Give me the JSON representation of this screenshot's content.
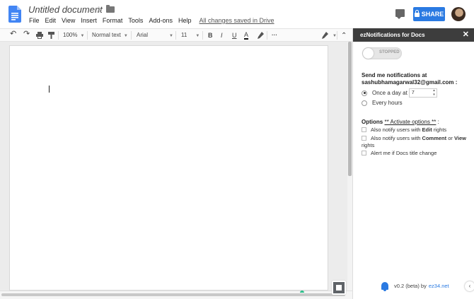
{
  "header": {
    "doc_title": "Untitled document",
    "menus": [
      "File",
      "Edit",
      "View",
      "Insert",
      "Format",
      "Tools",
      "Add-ons",
      "Help"
    ],
    "save_status": "All changes saved in Drive",
    "share_label": "SHARE",
    "accent_color": "#2a7ae2"
  },
  "toolbar": {
    "zoom": "100%",
    "style": "Normal text",
    "font": "Arial",
    "font_size": "11",
    "bold": "B",
    "italic": "I",
    "underline": "U",
    "text_color": "A",
    "more": "···",
    "collapse": "⌃"
  },
  "panel": {
    "title": "ezNotifications for Docs",
    "close": "✕",
    "toggle_state": "STOPPED",
    "send_label": "Send me notifications at sashubhamagarwal32@gmail.com :",
    "radio_once": "Once a day at",
    "once_value": "7",
    "radio_every": "Every hours",
    "options_prefix": "Options",
    "activate_link": "** Activate options **",
    "options_suffix": ":",
    "opt1_pre": "Also notify users with",
    "opt1_b": "Edit",
    "opt1_post": "rights",
    "opt2_pre": "Also notify users with",
    "opt2_b1": "Comment",
    "opt2_mid": "or",
    "opt2_b2": "View",
    "opt2_post": "rights",
    "opt3": "Alert me if Docs title change",
    "version": "v0.2 (beta) by",
    "version_link": "ez34.net"
  }
}
